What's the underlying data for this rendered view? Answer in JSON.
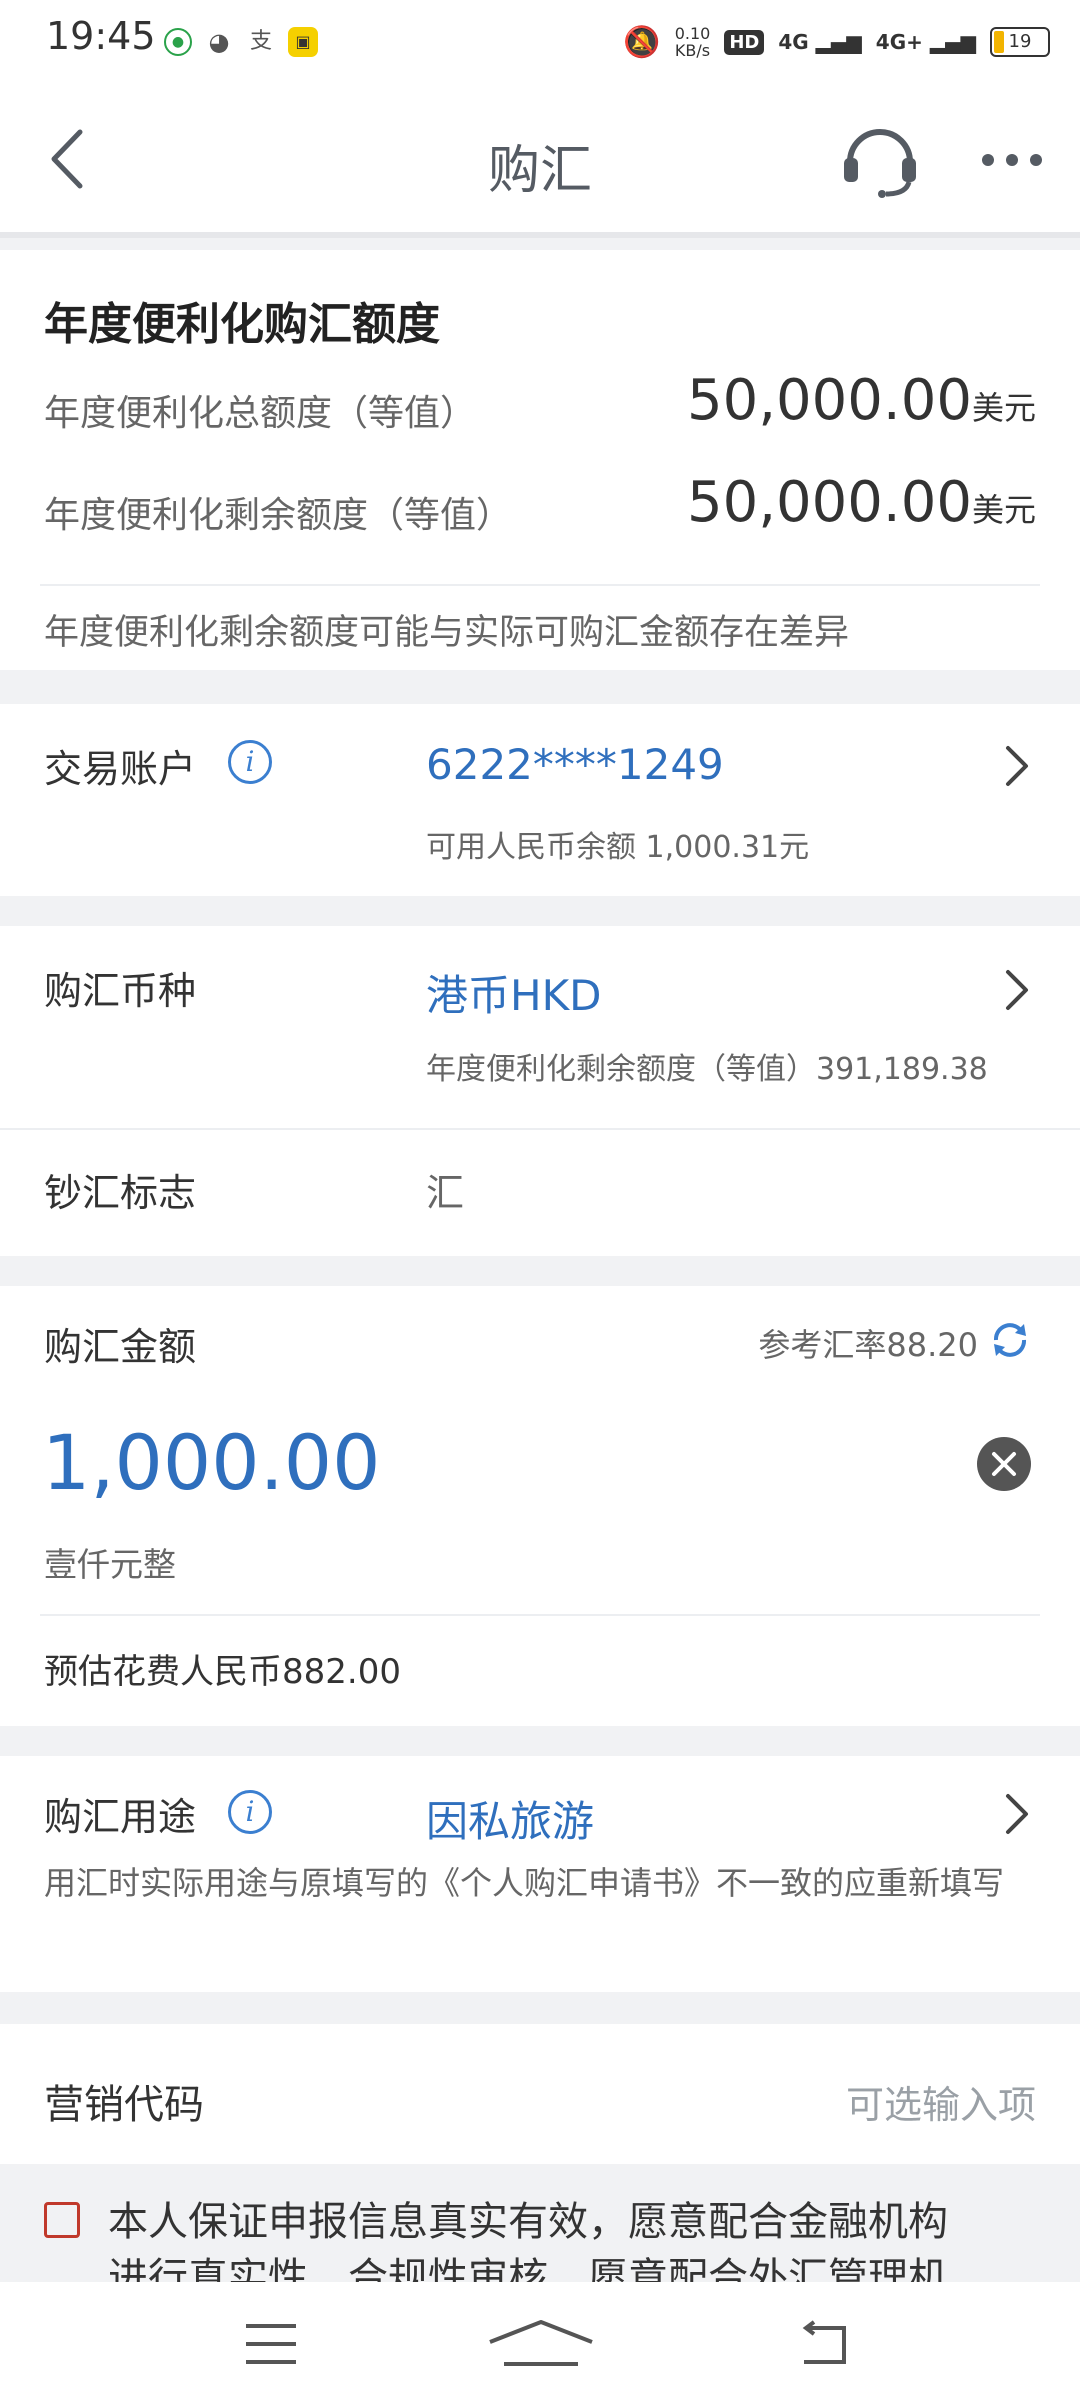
{
  "status_bar": {
    "time": "19:45",
    "net_speed": "0.10\nKB/s",
    "net_speed_line1": "0.10",
    "net_speed_line2": "KB/s",
    "hd": "HD",
    "signal1": "4G",
    "signal2": "4G+",
    "battery": "19"
  },
  "header": {
    "title": "购汇"
  },
  "quota": {
    "title": "年度便利化购汇额度",
    "total_label": "年度便利化总额度（等值）",
    "total_value": "50,000.00",
    "total_unit": "美元",
    "remain_label": "年度便利化剩余额度（等值）",
    "remain_value": "50,000.00",
    "remain_unit": "美元",
    "note": "年度便利化剩余额度可能与实际可购汇金额存在差异"
  },
  "account": {
    "label": "交易账户",
    "number": "6222****1249",
    "balance": "可用人民币余额 1,000.31元"
  },
  "currency": {
    "label": "购汇币种",
    "value": "港币HKD",
    "remain": "年度便利化剩余额度（等值）391,189.38"
  },
  "cash_flag": {
    "label": "钞汇标志",
    "value": "汇"
  },
  "amount": {
    "label": "购汇金额",
    "rate": "参考汇率88.20",
    "value": "1,000.00",
    "chinese": "壹仟元整",
    "estimate": "预估花费人民币882.00"
  },
  "purpose": {
    "label": "购汇用途",
    "value": "因私旅游",
    "note": "用汇时实际用途与原填写的《个人购汇申请书》不一致的应重新填写"
  },
  "marketing": {
    "label": "营销代码",
    "placeholder": "可选输入项"
  },
  "agreement": {
    "line1": "本人保证申报信息真实有效，愿意配合金融机构",
    "line2": "进行真实性、合规性审核，愿意配合外汇管理机"
  },
  "colors": {
    "accent": "#2f6fbd",
    "checkbox": "#c0392b"
  }
}
